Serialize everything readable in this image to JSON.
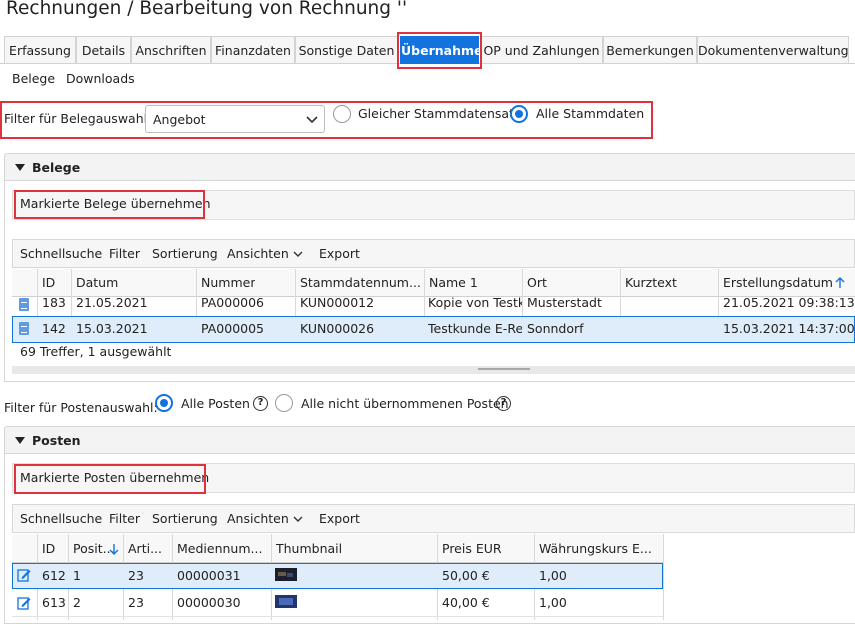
{
  "title": "Rechnungen / Bearbeitung von Rechnung ''",
  "tabs": [
    "Erfassung",
    "Details",
    "Anschriften",
    "Finanzdaten",
    "Sonstige Daten",
    "Übernahme",
    "OP und Zahlungen",
    "Bemerkungen",
    "Dokumentenverwaltung"
  ],
  "active_tab": "Übernahme",
  "subnav": [
    "Belege",
    "Downloads"
  ],
  "beleg_filter": {
    "label": "Filter für Belegauswahl:",
    "selected": "Angebot",
    "radio_same": "Gleicher Stammdatensatz",
    "radio_all": "Alle Stammdaten"
  },
  "belege": {
    "header": "Belege",
    "button": "Markierte Belege übernehmen",
    "toolbar": [
      "Schnellsuche",
      "Filter",
      "Sortierung",
      "Ansichten",
      "Export"
    ],
    "columns": [
      "ID",
      "Datum",
      "Nummer",
      "Stammdatennum...",
      "Name 1",
      "Ort",
      "Kurztext",
      "Erstellungsdatum"
    ],
    "rows": [
      [
        "183",
        "21.05.2021",
        "PA000006",
        "KUN000012",
        "Kopie von Testku",
        "Musterstadt",
        "",
        "21.05.2021 09:38:13"
      ],
      [
        "142",
        "15.03.2021",
        "PA000005",
        "KUN000026",
        "Testkunde E-Rec",
        "Sonndorf",
        "",
        "15.03.2021 14:37:00"
      ]
    ],
    "status": "69 Treffer, 1 ausgewählt"
  },
  "posten_filter": {
    "label": "Filter für Postenauswahl:",
    "radio_all": "Alle Posten",
    "radio_not": "Alle nicht übernommenen Posten"
  },
  "posten": {
    "header": "Posten",
    "button": "Markierte Posten übernehmen",
    "toolbar": [
      "Schnellsuche",
      "Filter",
      "Sortierung",
      "Ansichten",
      "Export"
    ],
    "columns": [
      "ID",
      "Posit...",
      "Arti...",
      "Mediennum...",
      "Thumbnail",
      "Preis EUR",
      "Währungskurs E..."
    ],
    "rows": [
      [
        "612",
        "1",
        "23",
        "00000031",
        "",
        "50,00 €",
        "1,00"
      ],
      [
        "613",
        "2",
        "23",
        "00000030",
        "",
        "40,00 €",
        "1,00"
      ]
    ]
  },
  "colors": {
    "accent": "#1273de",
    "highlight": "#e0323c",
    "selection": "#dfecf9"
  }
}
